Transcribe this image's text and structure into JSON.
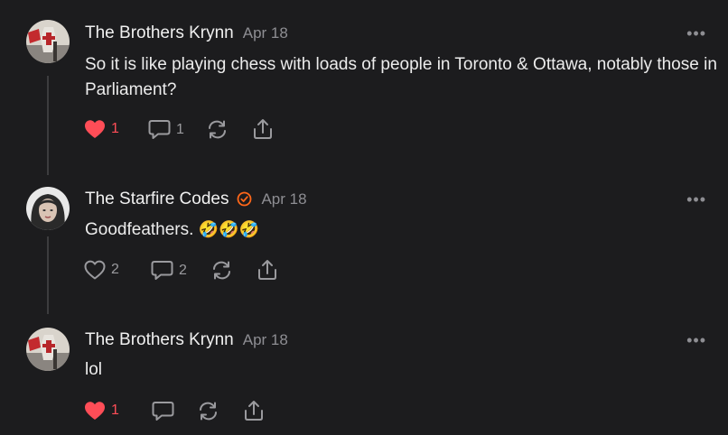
{
  "comments": [
    {
      "author": "The Brothers Krynn",
      "date": "Apr 18",
      "text": "So it is like playing chess with loads of people in Toronto & Ottawa, notably those in Parliament?",
      "likes": "1",
      "liked": true,
      "replies": "1"
    },
    {
      "author": "The Starfire Codes",
      "date": "Apr 18",
      "text": "Goodfeathers.",
      "emojis": "🤣🤣🤣",
      "likes": "2",
      "liked": false,
      "replies": "2",
      "verified": true
    },
    {
      "author": "The Brothers Krynn",
      "date": "Apr 18",
      "text": "lol",
      "likes": "1",
      "liked": true,
      "replies": ""
    }
  ],
  "more_label": "•••",
  "icons": [
    "heart-icon",
    "comment-icon",
    "restack-icon",
    "share-icon",
    "verified-icon"
  ],
  "colors": {
    "like_active": "#ff4d57",
    "verified": "#ff6719",
    "background": "#1c1c1e"
  }
}
